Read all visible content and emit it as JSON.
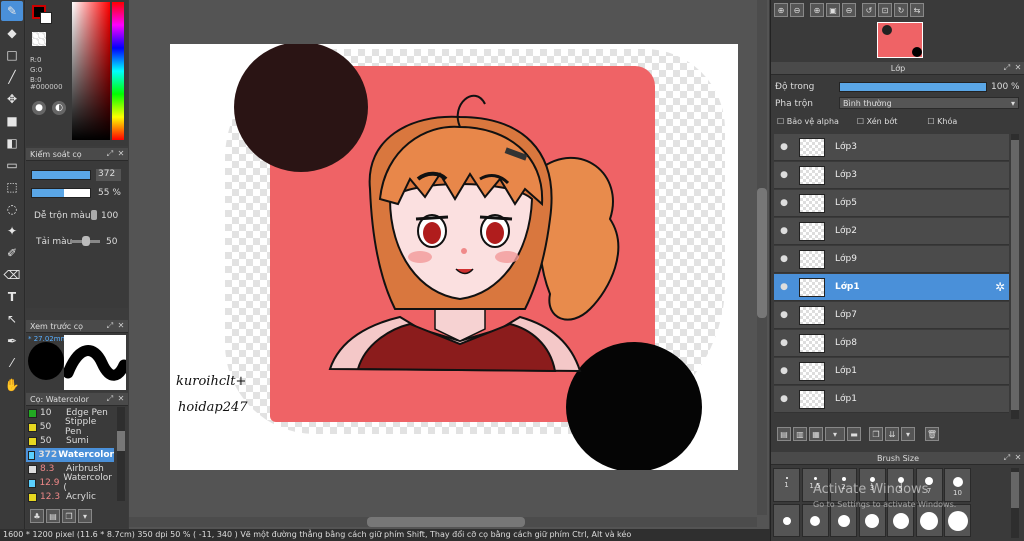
{
  "color_panel": {
    "rgb": [
      "R:0",
      "G:0",
      "B:0"
    ],
    "hex": "#000000",
    "primary_color": "#000000",
    "accent_color": "#cc0000"
  },
  "brush_control": {
    "title": "Kiểm soát cọ",
    "size_value": "372",
    "opacity_value": "55 %",
    "blend_label": "Dễ trộn màu",
    "blend_value": "100",
    "paint_label": "Tải màu",
    "paint_value": "50"
  },
  "preview": {
    "title": "Xem trước cọ",
    "size_label": "* 27.02mm"
  },
  "brush_list": {
    "title": "Cọ: Watercolor",
    "items": [
      {
        "size": "10",
        "name": "Edge Pen",
        "color": "#22aa22",
        "selected": false,
        "red": false
      },
      {
        "size": "50",
        "name": "Stipple Pen",
        "color": "#e8d820",
        "selected": false,
        "red": false
      },
      {
        "size": "50",
        "name": "Sumi",
        "color": "#e8d820",
        "selected": false,
        "red": false
      },
      {
        "size": "372",
        "name": "Watercolor",
        "color": "#5ad0ff",
        "selected": true,
        "red": false
      },
      {
        "size": "8.3",
        "name": "Airbrush",
        "color": "#dddddd",
        "selected": false,
        "red": true
      },
      {
        "size": "12.9",
        "name": "Watercolor (",
        "color": "#5ad0ff",
        "selected": false,
        "red": true
      },
      {
        "size": "12.3",
        "name": "Acrylic",
        "color": "#e8d820",
        "selected": false,
        "red": true
      }
    ]
  },
  "canvas": {
    "signature_line1": "kuroihclt+",
    "signature_line2": "hoidap247"
  },
  "layer_panel": {
    "title": "Lớp",
    "opacity_label": "Độ trong",
    "opacity_value": "100 %",
    "opacity_fraction": 1.0,
    "blend_label": "Pha trộn",
    "blend_value": "Bình thường",
    "protect_alpha": "Bảo vệ alpha",
    "clipping": "Xén bớt",
    "lock": "Khóa",
    "layers": [
      {
        "name": "Lớp3",
        "selected": false
      },
      {
        "name": "Lớp3",
        "selected": false
      },
      {
        "name": "Lớp5",
        "selected": false
      },
      {
        "name": "Lớp2",
        "selected": false
      },
      {
        "name": "Lớp9",
        "selected": false
      },
      {
        "name": "Lớp1",
        "selected": true
      },
      {
        "name": "Lớp7",
        "selected": false
      },
      {
        "name": "Lớp8",
        "selected": false
      },
      {
        "name": "Lớp1",
        "selected": false
      },
      {
        "name": "Lớp1",
        "selected": false
      }
    ]
  },
  "brush_size": {
    "title": "Brush Size",
    "sizes": [
      "1",
      "1.5",
      "2",
      "3",
      "5",
      "7",
      "10"
    ],
    "watermark_line1": "Activate Windows",
    "watermark_line2": "Go to Settings to activate Windows."
  },
  "status": {
    "text": "1600 * 1200 pixel   (11.6 * 8.7cm)   350 dpi   50 %   ( -11, 340 )   Vẽ một đường thẳng bằng cách giữ phím Shift, Thay đổi cỡ cọ bằng cách giữ phím Ctrl, Alt và kéo"
  }
}
